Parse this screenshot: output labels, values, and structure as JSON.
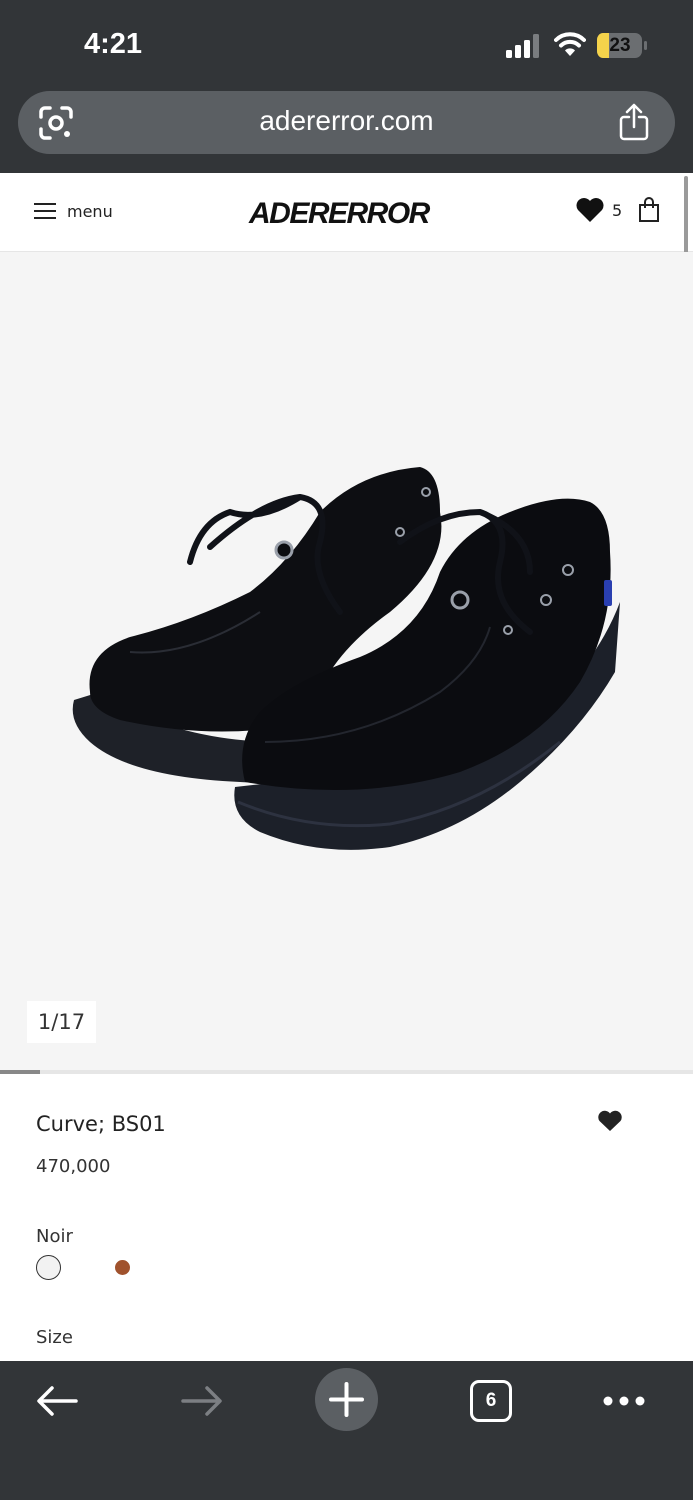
{
  "status_bar": {
    "time": "4:21",
    "battery": "23"
  },
  "browser": {
    "url": "adererror.com",
    "tab_count": "6"
  },
  "header": {
    "menu_label": "menu",
    "logo": "ADERERROR",
    "wishlist_count": "5"
  },
  "gallery": {
    "counter": "1/17",
    "progress_fraction": 0.058
  },
  "product": {
    "name": "Curve; BS01",
    "price": "470,000",
    "color_label": "Noir",
    "swatches": [
      {
        "name": "Noir",
        "color": "#f2f2f2",
        "selected": true
      },
      {
        "name": "brown",
        "color": "#a0522d",
        "selected": false
      }
    ],
    "size_label": "Size"
  },
  "colors": {
    "chrome": "#323538",
    "url_pill": "#5b5f63",
    "gallery_bg": "#f5f5f5",
    "battery": "#f5d34b"
  }
}
